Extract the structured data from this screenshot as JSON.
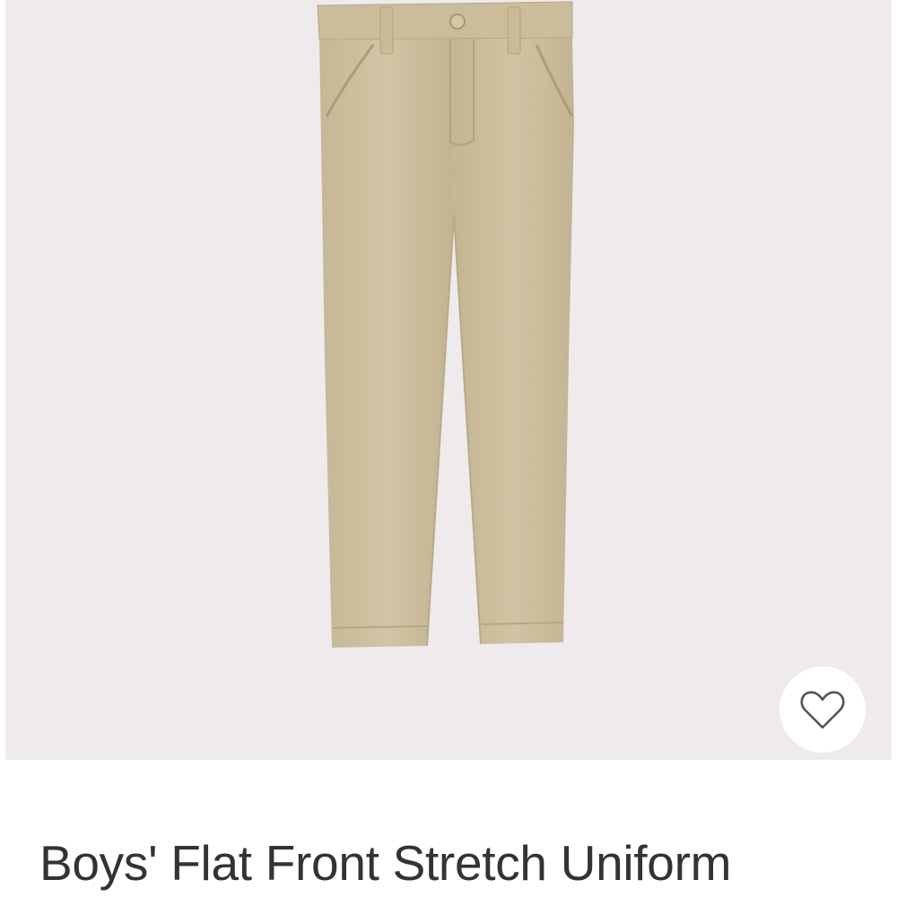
{
  "product": {
    "title": "Boys' Flat Front Stretch Uniform",
    "image_subject": "khaki uniform pants",
    "image_background": "#eeeaee",
    "pants_color": "#cdbf9f"
  },
  "favorite": {
    "icon": "heart-outline-icon"
  }
}
